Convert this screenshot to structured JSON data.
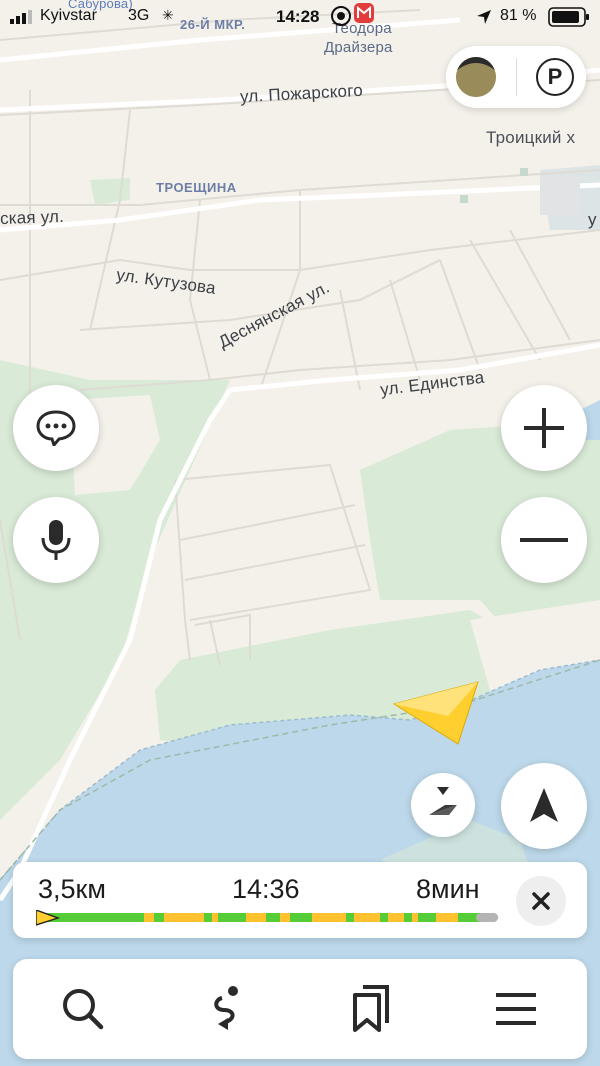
{
  "status_bar": {
    "carrier": "Kyivstar",
    "network": "3G",
    "time": "14:28",
    "battery": "81 %"
  },
  "map": {
    "labels": {
      "saburova": "Сабурова)",
      "district_26": "26-Й МКР.",
      "theodore_1": "Теодора",
      "theodore_2": "Драйзера",
      "pozharskogo": "ул. Пожарского",
      "troitsky": "Троицкий х",
      "troeshchina": "ТРОЕЩИНА",
      "skaya": "ская ул.",
      "kutuzova": "ул. Кутузова",
      "desnyanskaya": "Деснянская ул.",
      "yedinstva": "ул. Единства",
      "edge_u": "у"
    },
    "colors": {
      "land": "#f4f1ea",
      "park": "#d9ead7",
      "water": "#bcd8ea",
      "route_green": "#55cc38",
      "route_yellow": "#ffc22e"
    }
  },
  "top_controls": {
    "avatar_icon": "avatar-icon",
    "parking_label": "P"
  },
  "side_buttons": {
    "chat_icon": "chat-bubble-icon",
    "mic_icon": "microphone-icon",
    "zoom_in_icon": "plus-icon",
    "zoom_out_icon": "minus-icon",
    "compass_icon": "compass-icon",
    "locate_icon": "navigation-arrow-icon"
  },
  "route_summary": {
    "distance": "3,5км",
    "arrival_time": "14:36",
    "duration": "8мин",
    "progress_fraction": 0.0
  },
  "bottom_nav": {
    "items": [
      {
        "icon": "search-icon"
      },
      {
        "icon": "route-icon"
      },
      {
        "icon": "bookmarks-icon"
      },
      {
        "icon": "menu-icon"
      }
    ]
  }
}
